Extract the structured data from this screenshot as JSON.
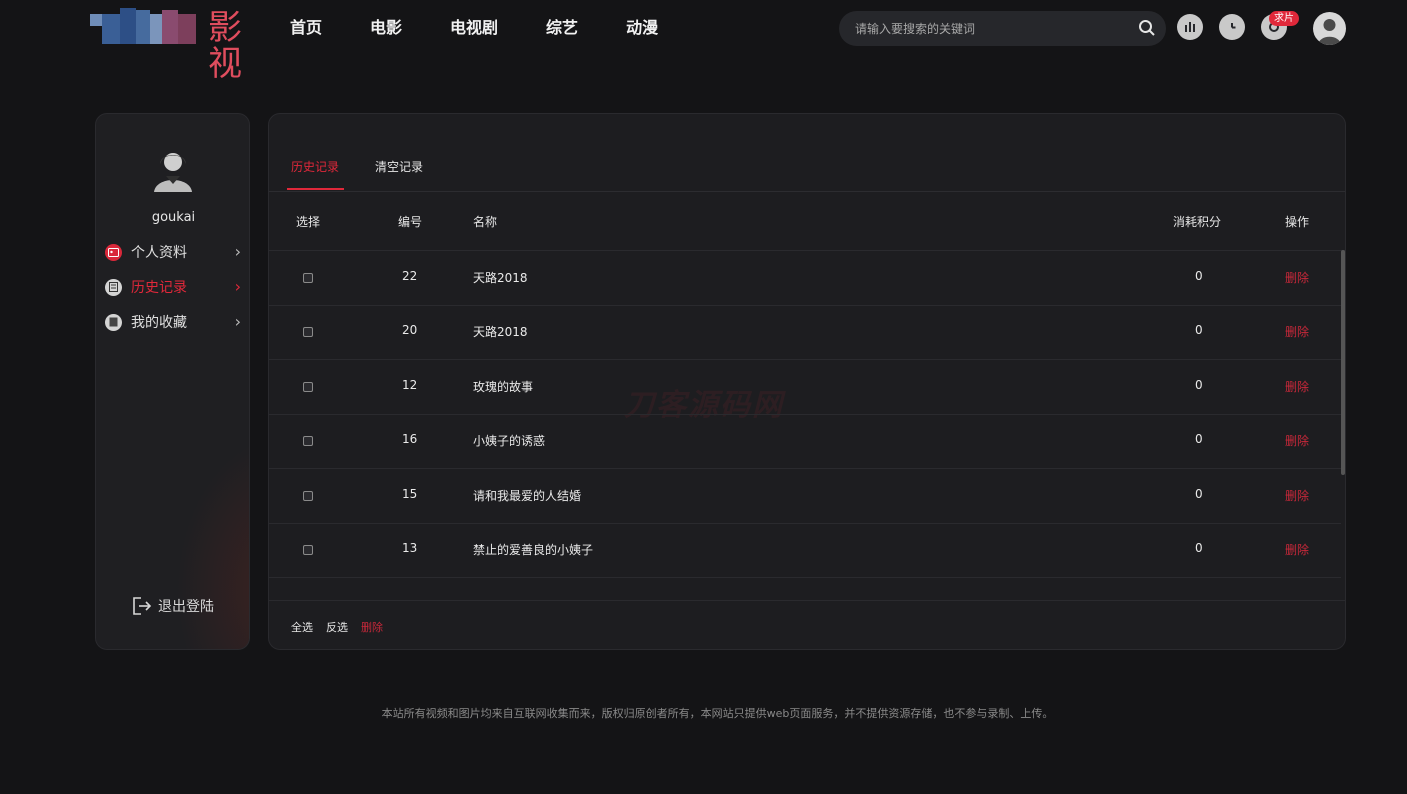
{
  "header": {
    "logo_text": "影视",
    "nav": [
      "首页",
      "电影",
      "电视剧",
      "综艺",
      "动漫"
    ],
    "search_placeholder": "请输入要搜索的关键词",
    "badge": "求片"
  },
  "sidebar": {
    "username": "goukai",
    "items": [
      {
        "label": "个人资料",
        "icon": "id-card-icon",
        "active": false
      },
      {
        "label": "历史记录",
        "icon": "history-icon",
        "active": true
      },
      {
        "label": "我的收藏",
        "icon": "favorite-icon",
        "active": false
      }
    ],
    "logout": "退出登陆"
  },
  "main": {
    "tabs": [
      "历史记录",
      "清空记录"
    ],
    "columns": {
      "select": "选择",
      "id": "编号",
      "name": "名称",
      "points": "消耗积分",
      "action": "操作"
    },
    "rows": [
      {
        "id": "22",
        "name": "天路2018",
        "points": "0",
        "action": "删除"
      },
      {
        "id": "20",
        "name": "天路2018",
        "points": "0",
        "action": "删除"
      },
      {
        "id": "12",
        "name": "玫瑰的故事",
        "points": "0",
        "action": "删除"
      },
      {
        "id": "16",
        "name": "小姨子的诱惑",
        "points": "0",
        "action": "删除"
      },
      {
        "id": "15",
        "name": "请和我最爱的人结婚",
        "points": "0",
        "action": "删除"
      },
      {
        "id": "13",
        "name": "禁止的爱善良的小姨子",
        "points": "0",
        "action": "删除"
      }
    ],
    "bottom": {
      "select_all": "全选",
      "invert": "反选",
      "delete": "删除"
    },
    "watermark": "刀客源码网"
  },
  "footer": {
    "copyright": "本站所有视频和图片均来自互联网收集而来，版权归原创者所有，本网站只提供web页面服务，并不提供资源存储，也不参与录制、上传。"
  },
  "colors": {
    "accent": "#e0283a",
    "background": "#141416",
    "panel": "#1d1d20"
  }
}
